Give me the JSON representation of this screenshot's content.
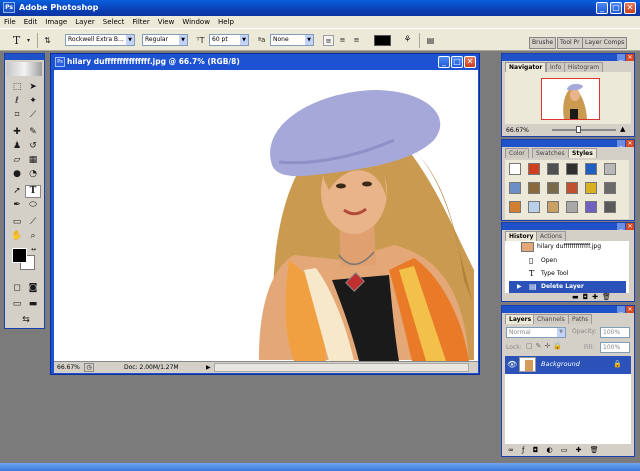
{
  "app": {
    "title": "Adobe Photoshop",
    "logo_text": "Ps"
  },
  "window_controls": {
    "minimize": "_",
    "maximize": "□",
    "close": "✕"
  },
  "menu": [
    "File",
    "Edit",
    "Image",
    "Layer",
    "Select",
    "Filter",
    "View",
    "Window",
    "Help"
  ],
  "options_bar": {
    "font_family": "Rockwell Extra B...",
    "font_style": "Regular",
    "font_size": "60 pt",
    "antialias": "None",
    "text_color": "#000000",
    "palette_tabs": [
      "Brushe",
      "Tool Pr",
      "Layer Comps"
    ]
  },
  "document": {
    "title": "hilary dufffffffffffffff.jpg @ 66.7% (RGB/8)",
    "zoom": "66.67%",
    "doc_size": "Doc: 2.00M/1.27M"
  },
  "navigator": {
    "tabs": [
      "Navigator",
      "Info",
      "Histogram"
    ],
    "zoom": "66.67%"
  },
  "styles_panel": {
    "tabs": [
      "Color",
      "Swatches",
      "Styles"
    ],
    "swatch_colors": [
      "#ffffff",
      "#d04020",
      "#505050",
      "#303030",
      "#2060c0",
      "#b8b8b8",
      "#6a8fc8",
      "#8a6a3a",
      "#7a6a4a",
      "#c05030",
      "#d8b020",
      "#6a6a6a",
      "#d08030",
      "#b8d0e8",
      "#c8a060",
      "#a8a8a8",
      "#7060c0",
      "#5a5a5a"
    ]
  },
  "history_panel": {
    "tabs": [
      "History",
      "Actions"
    ],
    "snapshot_name": "hilary dufffffffffffff.jpg",
    "items": [
      {
        "label": "Open",
        "icon": "document-icon"
      },
      {
        "label": "Type Tool",
        "icon": "type-tool-icon"
      },
      {
        "label": "Delete Layer",
        "icon": "delete-layer-icon",
        "selected": true
      }
    ]
  },
  "layers_panel": {
    "tabs": [
      "Layers",
      "Channels",
      "Paths"
    ],
    "blend_mode": "Normal",
    "opacity_label": "Opacity:",
    "opacity": "100%",
    "lock_label": "Lock:",
    "fill_label": "Fill:",
    "fill": "100%",
    "layers": [
      {
        "name": "Background",
        "visible": true,
        "locked": true
      }
    ]
  }
}
